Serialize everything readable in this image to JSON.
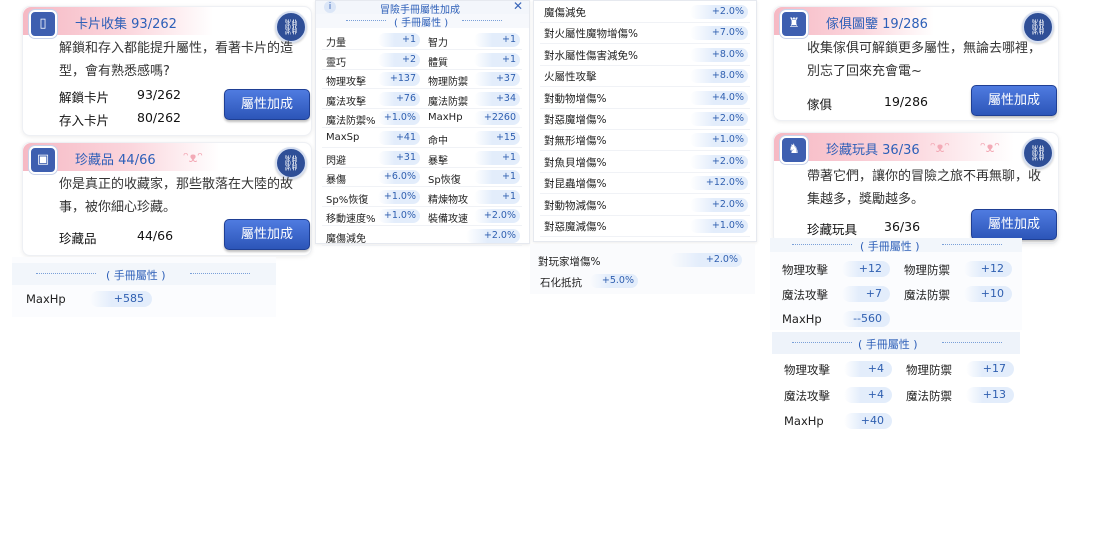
{
  "card_collection": {
    "title": "卡片收集",
    "count": "93/262",
    "desc_line1": "解鎖和存入都能提升屬性，看著卡片的造",
    "desc_line2": "型，會有熟悉感嗎?",
    "stats": [
      {
        "label": "解鎖卡片",
        "value": "93/262"
      },
      {
        "label": "存入卡片",
        "value": "80/262"
      }
    ],
    "button": "屬性加成"
  },
  "treasure": {
    "title": "珍藏品",
    "count": "44/66",
    "desc_line1": "你是真正的收藏家，那些散落在大陸的故",
    "desc_line2": "事，被你細心珍藏。",
    "stats": [
      {
        "label": "珍藏品",
        "value": "44/66"
      }
    ],
    "button": "屬性加成"
  },
  "left_section": {
    "title": "手冊屬性",
    "rows": [
      {
        "label": "MaxHp",
        "value": "+585"
      }
    ]
  },
  "adventure_panel": {
    "title": "冒險手冊屬性加成",
    "section": "手冊屬性",
    "rows": [
      [
        "力量",
        "+1",
        "智力",
        "+1"
      ],
      [
        "靈巧",
        "+2",
        "體質",
        "+1"
      ],
      [
        "物理攻擊",
        "+137",
        "物理防禦",
        "+37"
      ],
      [
        "魔法攻擊",
        "+76",
        "魔法防禦",
        "+34"
      ],
      [
        "魔法防禦%",
        "+1.0%",
        "MaxHp",
        "+2260"
      ],
      [
        "MaxSp",
        "+41",
        "命中",
        "+15"
      ],
      [
        "閃避",
        "+31",
        "暴擊",
        "+1"
      ],
      [
        "暴傷",
        "+6.0%",
        "Sp恢復",
        "+1"
      ],
      [
        "Sp%恢復",
        "+1.0%",
        "精煉物攻",
        "+1"
      ],
      [
        "移動速度%",
        "+1.0%",
        "裝備攻速",
        "+2.0%"
      ],
      [
        "魔傷減免",
        "+2.0%",
        "",
        ""
      ]
    ]
  },
  "middle_list": {
    "rows": [
      [
        "魔傷減免",
        "+2.0%"
      ],
      [
        "對火屬性魔物增傷%",
        "+7.0%"
      ],
      [
        "對水屬性傷害減免%",
        "+8.0%"
      ],
      [
        "火屬性攻擊",
        "+8.0%"
      ],
      [
        "對動物增傷%",
        "+4.0%"
      ],
      [
        "對惡魔增傷%",
        "+2.0%"
      ],
      [
        "對無形增傷%",
        "+1.0%"
      ],
      [
        "對魚貝增傷%",
        "+2.0%"
      ],
      [
        "對昆蟲增傷%",
        "+12.0%"
      ],
      [
        "對動物減傷%",
        "+2.0%"
      ],
      [
        "對惡魔減傷%",
        "+1.0%"
      ]
    ],
    "extra": [
      [
        "對玩家增傷%",
        "+2.0%"
      ],
      [
        "石化抵抗",
        "+5.0%"
      ]
    ]
  },
  "furniture": {
    "title": "傢俱圖鑒",
    "count": "19/286",
    "desc_line1": "收集傢俱可解鎖更多屬性，無論去哪裡，",
    "desc_line2": "別忘了回來充會電~",
    "stats": [
      {
        "label": "傢俱",
        "value": "19/286"
      }
    ],
    "button": "屬性加成"
  },
  "toys": {
    "title": "珍藏玩具",
    "count": "36/36",
    "desc_line1": "帶著它們，讓你的冒險之旅不再無聊，收",
    "desc_line2": "集越多，獎勵越多。",
    "stats": [
      {
        "label": "珍藏玩具",
        "value": "36/36"
      }
    ],
    "button": "屬性加成"
  },
  "right_section1": {
    "title": "手冊屬性",
    "rows": [
      [
        "物理攻擊",
        "+12",
        "物理防禦",
        "+12"
      ],
      [
        "魔法攻擊",
        "+7",
        "魔法防禦",
        "+10"
      ],
      [
        "MaxHp",
        "--560",
        "",
        ""
      ]
    ]
  },
  "right_section2": {
    "title": "手冊屬性",
    "rows": [
      [
        "物理攻擊",
        "+4",
        "物理防禦",
        "+17"
      ],
      [
        "魔法攻擊",
        "+4",
        "魔法防禦",
        "+13"
      ],
      [
        "MaxHp",
        "+40",
        "",
        ""
      ]
    ]
  },
  "icons": {
    "link": "link-icon",
    "close": "close-icon",
    "info": "info-icon"
  }
}
